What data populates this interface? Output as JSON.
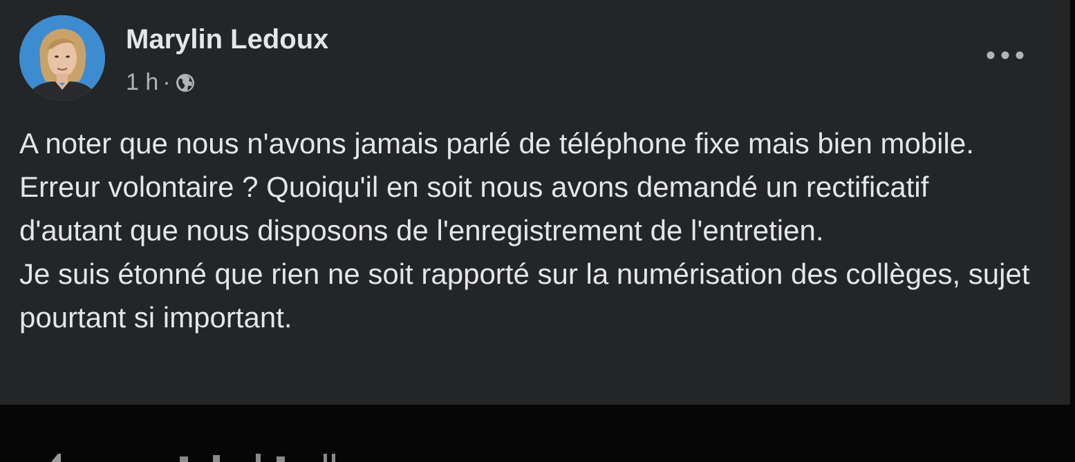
{
  "post": {
    "author": "Marylin Ledoux",
    "timestamp": "1 h",
    "separator": "·",
    "audience_icon": "globe-icon",
    "more_icon": "more-options-icon",
    "text": "A noter que nous n'avons jamais parlé de téléphone fixe mais bien mobile. Erreur volontaire ? Quoiqu'il en soit nous avons demandé un rectificatif d'autant que nous disposons de l'enregistrement de l'entretien.\nJe suis étonné que rien ne soit rapporté sur la numérisation des collèges, sujet pourtant si important."
  },
  "colors": {
    "post_background": "#242526",
    "page_background": "#070708",
    "primary_text": "#e4e6eb",
    "secondary_text": "#b0b3b8",
    "avatar_background": "#3d8cd0"
  }
}
